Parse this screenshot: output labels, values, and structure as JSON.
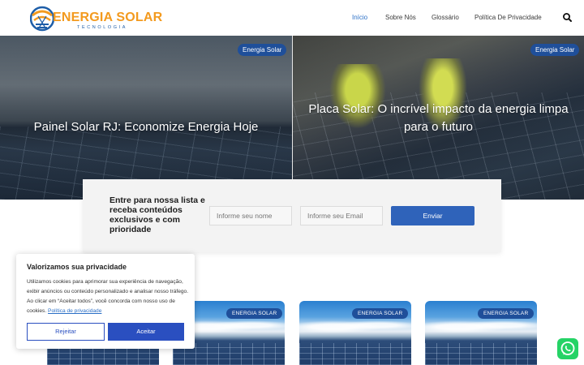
{
  "header": {
    "logo_text": "ENERGIA SOLAR",
    "logo_subtext": "TECNOLOGIA",
    "nav": [
      {
        "label": "Início",
        "active": true
      },
      {
        "label": "Sobre Nós",
        "active": false
      },
      {
        "label": "Glossário",
        "active": false
      },
      {
        "label": "Política De Privacidade",
        "active": false
      }
    ],
    "search_icon": "search-icon"
  },
  "hero": {
    "left": {
      "badge": "Energia Solar",
      "title": "Painel Solar RJ: Economize Energia Hoje"
    },
    "right": {
      "badge": "Energia Solar",
      "title": "Placa Solar: O incrível impacto da energia limpa para o futuro"
    }
  },
  "newsletter": {
    "title": "Entre para nossa lista e receba conteúdos exclusivos e com prioridade",
    "name_placeholder": "Informe seu nome",
    "email_placeholder": "Informe seu Email",
    "submit_label": "Enviar"
  },
  "cards": [
    {
      "badge": ""
    },
    {
      "badge": "ENERGIA SOLAR"
    },
    {
      "badge": "ENERGIA SOLAR"
    },
    {
      "badge": "ENERGIA SOLAR"
    }
  ],
  "cookie": {
    "title": "Valorizamos sua privacidade",
    "text": "Utilizamos cookies para aprimorar sua experiência de navegação, exibir anúncios ou conteúdo personalizado e analisar nosso tráfego. Ao clicar em “Aceitar todos”, você concorda com nosso uso de cookies.",
    "link": "Política de privacidade",
    "reject_label": "Rejeitar",
    "accept_label": "Aceitar"
  },
  "colors": {
    "accent": "#2a6fc6",
    "badge": "#1f4f9a",
    "button": "#2f63ba",
    "logo_orange": "#f39a1e",
    "whatsapp": "#25d366"
  },
  "floating": {
    "whatsapp_icon": "whatsapp-icon"
  }
}
